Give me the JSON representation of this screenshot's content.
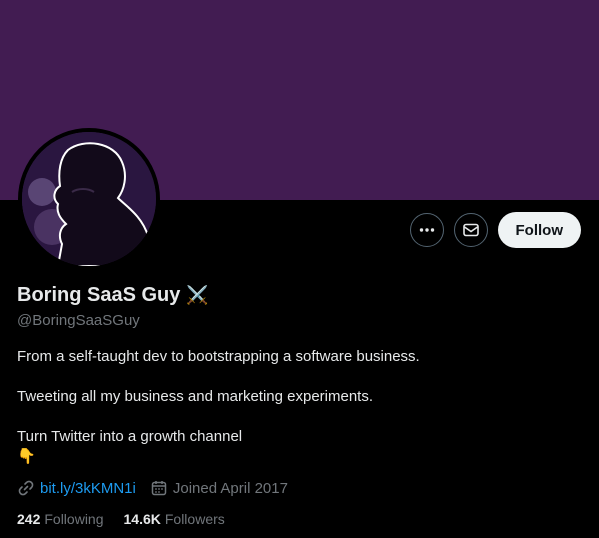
{
  "profile": {
    "display_name": "Boring SaaS Guy",
    "name_emoji": "⚔️",
    "handle": "@BoringSaaSGuy",
    "bio_lines": [
      "From a self-taught dev to bootstrapping a software business.",
      "Tweeting all my business and marketing experiments.",
      "Turn Twitter into a growth channel",
      "👇"
    ],
    "link_text": "bit.ly/3kKMN1i",
    "joined_text": "Joined April 2017",
    "following_count": "242",
    "following_label": "Following",
    "followers_count": "14.6K",
    "followers_label": "Followers"
  },
  "actions": {
    "more_icon": "more-horizontal-icon",
    "message_icon": "envelope-icon",
    "follow_label": "Follow"
  },
  "colors": {
    "banner": "#421c52",
    "background": "#000000",
    "accent_link": "#1d9bf0",
    "muted_text": "#71767b",
    "follow_button_bg": "#eff3f4"
  }
}
